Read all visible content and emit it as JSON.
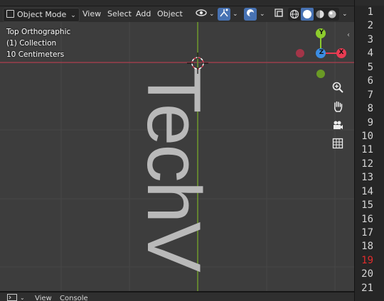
{
  "header": {
    "mode_label": "Object Mode",
    "menu": [
      "View",
      "Select",
      "Add",
      "Object"
    ]
  },
  "overlay": {
    "view_name": "Top Orthographic",
    "collection": "(1) Collection",
    "scale": "10 Centimeters"
  },
  "scene": {
    "text_object": "TechV"
  },
  "gizmo": {
    "y_label": "Y",
    "z_label": "Z",
    "x_label": "X",
    "colors": {
      "x": "#e83b52",
      "y": "#8dcc2d",
      "z": "#3b8de3"
    }
  },
  "bottom_header": {
    "menu": [
      "View",
      "Console"
    ]
  },
  "text_editor": {
    "line_numbers": [
      "1",
      "2",
      "3",
      "4",
      "5",
      "6",
      "7",
      "8",
      "9",
      "10",
      "11",
      "12",
      "13",
      "14",
      "15",
      "16",
      "17",
      "18",
      "19",
      "20",
      "21"
    ],
    "current_line": "19"
  },
  "icons": [
    "object-mode-icon",
    "visibility-icon",
    "gizmo-icon",
    "overlays-icon",
    "xray-icon",
    "wireframe-shading-icon",
    "solid-shading-icon",
    "material-shading-icon",
    "rendered-shading-icon",
    "zoom-icon",
    "hand-pan-icon",
    "camera-icon",
    "grid-ortho-icon",
    "cursor-3d-icon"
  ]
}
